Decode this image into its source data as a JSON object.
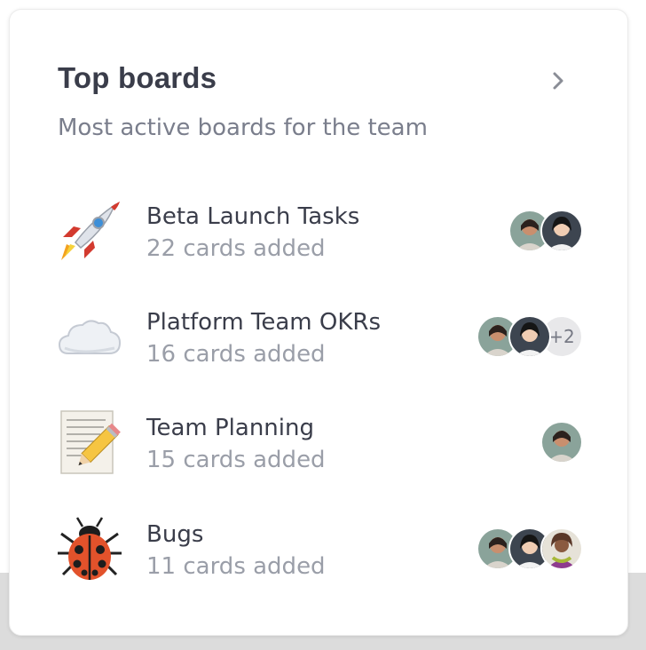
{
  "widget": {
    "title": "Top boards",
    "subtitle": "Most active boards for the team",
    "chevron_icon": "chevron-right-icon"
  },
  "boards": [
    {
      "name": "Beta Launch Tasks",
      "count": "22 cards added",
      "icon": "rocket-icon",
      "avatars": [
        "avatar-a",
        "avatar-b"
      ],
      "more": ""
    },
    {
      "name": "Platform Team OKRs",
      "count": "16 cards added",
      "icon": "cloud-icon",
      "avatars": [
        "avatar-a",
        "avatar-b"
      ],
      "more": "+2"
    },
    {
      "name": "Team Planning",
      "count": "15 cards added",
      "icon": "memo-icon",
      "avatars": [
        "avatar-a"
      ],
      "more": ""
    },
    {
      "name": "Bugs",
      "count": "11 cards added",
      "icon": "ladybug-icon",
      "avatars": [
        "avatar-a",
        "avatar-b",
        "avatar-c"
      ],
      "more": ""
    }
  ]
}
